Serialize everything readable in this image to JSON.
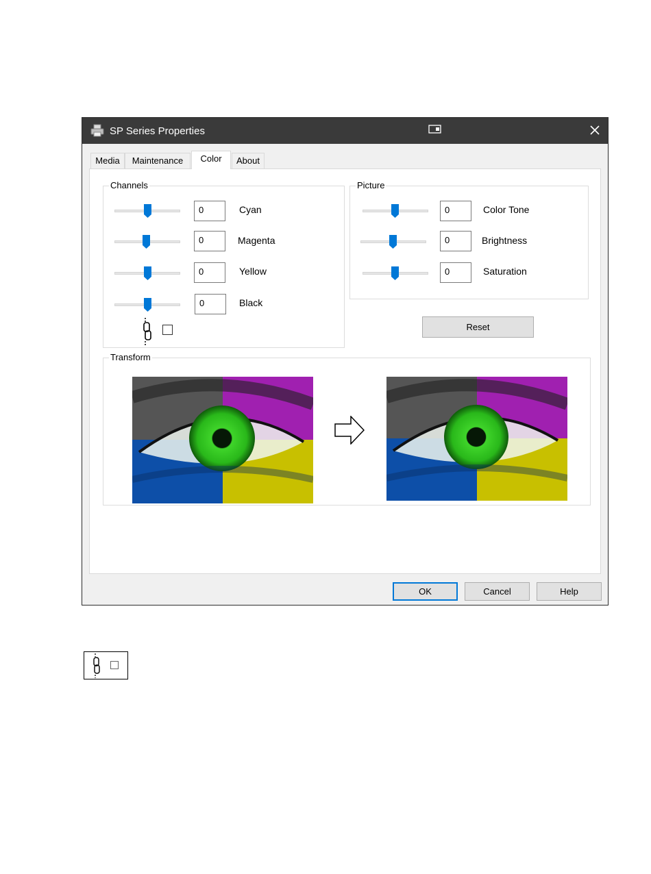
{
  "window": {
    "title": "SP Series Properties"
  },
  "tabs": [
    {
      "label": "Media",
      "active": false
    },
    {
      "label": "Maintenance",
      "active": false
    },
    {
      "label": "Color",
      "active": true
    },
    {
      "label": "About",
      "active": false
    }
  ],
  "channels": {
    "legend": "Channels",
    "items": [
      {
        "label": "Cyan",
        "value": "0"
      },
      {
        "label": "Magenta",
        "value": "0"
      },
      {
        "label": "Yellow",
        "value": "0"
      },
      {
        "label": "Black",
        "value": "0"
      }
    ],
    "link_checked": false
  },
  "picture": {
    "legend": "Picture",
    "items": [
      {
        "label": "Color Tone",
        "value": "0"
      },
      {
        "label": "Brightness",
        "value": "0"
      },
      {
        "label": "Saturation",
        "value": "0"
      }
    ]
  },
  "reset_label": "Reset",
  "transform": {
    "legend": "Transform"
  },
  "buttons": {
    "ok": "OK",
    "cancel": "Cancel",
    "help": "Help"
  },
  "icons": {
    "app": "printer-icon",
    "snap": "snap-layout-icon",
    "close": "close-icon",
    "link": "chain-link-icon",
    "arrow": "arrow-right-icon"
  },
  "colors": {
    "accent": "#0078d7",
    "titlebar": "#3a3a3a",
    "slider_thumb": "#0078d7"
  },
  "legend_figure": {
    "link_checked": false
  }
}
